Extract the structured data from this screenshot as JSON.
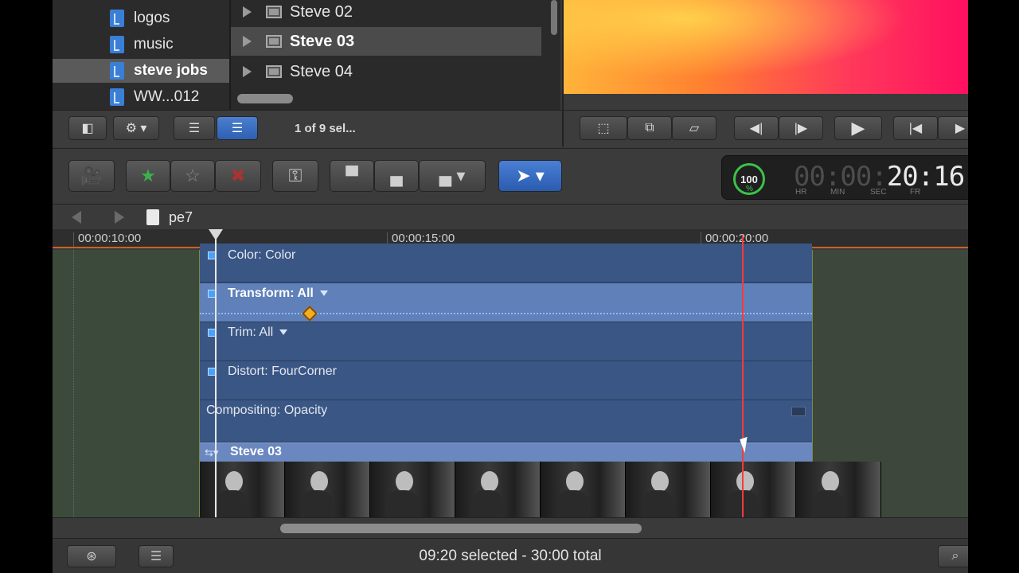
{
  "libraries": [
    {
      "label": "logos",
      "selected": false
    },
    {
      "label": "music",
      "selected": false
    },
    {
      "label": "steve jobs",
      "selected": true
    },
    {
      "label": "WW...012",
      "selected": false
    }
  ],
  "browser": {
    "clips": [
      {
        "label": "Steve 02",
        "selected": false
      },
      {
        "label": "Steve 03",
        "selected": true
      },
      {
        "label": "Steve 04",
        "selected": false
      }
    ],
    "selection_count": "1 of 9 sel..."
  },
  "timecode": {
    "percent": "100",
    "percent_sign": "%",
    "dim_digits": "00:00:",
    "value": "20:16",
    "units": [
      "HR",
      "MIN",
      "SEC",
      "FR"
    ]
  },
  "timeline": {
    "project_name": "pe7",
    "ruler_labels": [
      "00:00:10:00",
      "00:00:15:00",
      "00:00:20:00"
    ],
    "effects": [
      {
        "label": "Color: Color",
        "dropdown": false,
        "active": false
      },
      {
        "label": "Transform: All",
        "dropdown": true,
        "active": true
      },
      {
        "label": "Trim: All",
        "dropdown": true,
        "active": false
      },
      {
        "label": "Distort: FourCorner",
        "dropdown": false,
        "active": false
      },
      {
        "label": "Compositing: Opacity",
        "dropdown": false,
        "active": false
      }
    ],
    "clip_name": "Steve 03"
  },
  "status": {
    "text": "09:20 selected - 30:00 total"
  },
  "icons": {
    "toolbar": [
      "import-icon",
      "favorite-star-icon",
      "unrate-star-icon",
      "reject-icon",
      "keyword-icon",
      "connect-clip-icon",
      "insert-clip-icon",
      "append-clip-icon",
      "select-tool-icon"
    ]
  },
  "colors": {
    "accent_blue": "#2e5fb0",
    "skimmer_red": "#ff3a3a",
    "keyframe": "#f0b020",
    "timecode_ring": "#3cc24a"
  }
}
